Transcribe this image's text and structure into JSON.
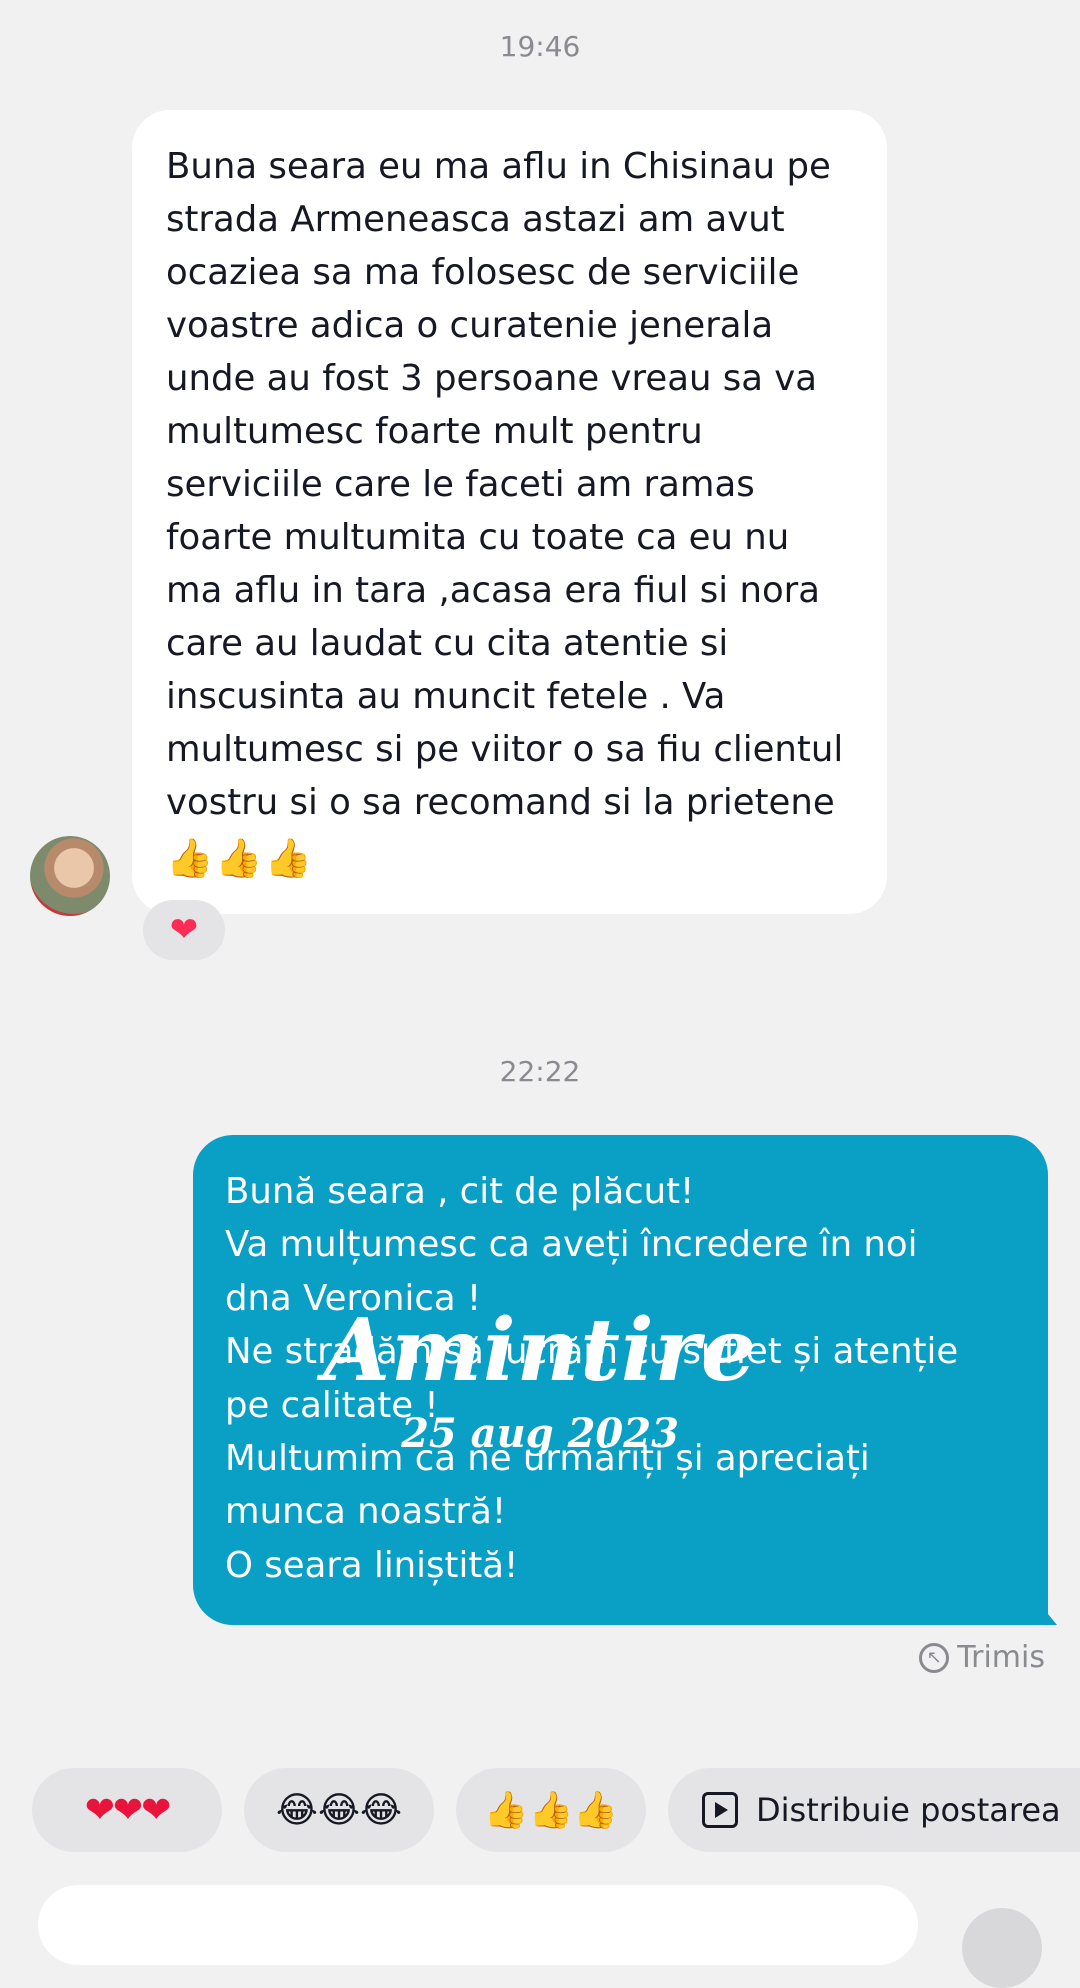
{
  "conversation": {
    "timestamp_1": "19:46",
    "incoming_message": {
      "text": "Buna seara eu ma aflu in Chisinau pe\nstrada Armeneasca astazi am avut\nocaziea sa ma folosesc de serviciile\nvoastre adica o curatenie jenerala\nunde au fost 3 persoane vreau sa va\nmultumesc foarte mult pentru\nserviciile care le faceti am ramas\nfoarte multumita cu toate ca eu nu\nma aflu in tara ,acasa  era fiul si nora\ncare au laudat cu cita atentie si\ninscusinta au muncit fetele . Va\nmultumesc si pe viitor o sa fiu clientul\nvostru si o sa recomand si la prietene",
      "emojis": "👍👍👍",
      "reaction": "❤"
    },
    "timestamp_2": "22:22",
    "outgoing_message": {
      "text": "Bună seara , cit de plăcut!\nVa mulțumesc ca aveți încredere în noi\ndna Veronica !\nNe stradăm să lucrăm cu suflet și atenție\npe calitate !\nMultumim ca ne urmăriți și apreciați\nmunca noastră!\nO seara liniștită!",
      "status": "Trimis"
    },
    "watermark": {
      "title": "Amintire",
      "date": "25 aug 2023"
    }
  },
  "quick_replies": [
    {
      "label": "❤❤❤"
    },
    {
      "label": "😂😂😂"
    },
    {
      "label": "👍👍👍"
    },
    {
      "label": "Distribuie postarea"
    }
  ],
  "colors": {
    "background": "#f1f1f2",
    "outgoing_bubble": "#0a9fc4",
    "incoming_bubble": "#ffffff"
  }
}
